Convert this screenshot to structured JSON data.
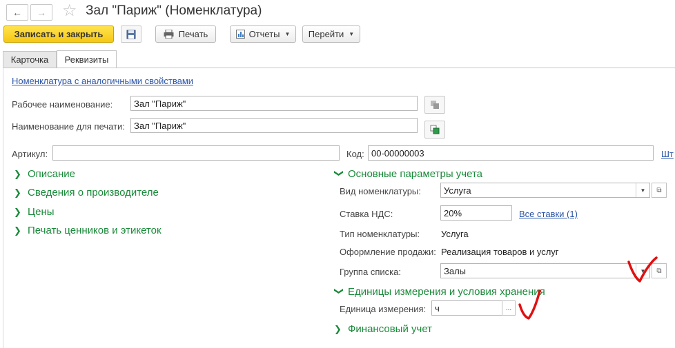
{
  "window": {
    "title": "Зал \"Париж\" (Номенклатура)",
    "back_icon": "arrow-left-icon",
    "forward_icon": "arrow-right-icon",
    "favorite_icon": "star-icon"
  },
  "toolbar": {
    "save_close": "Записать и закрыть",
    "print": "Печать",
    "reports": "Отчеты",
    "goto": "Перейти"
  },
  "tabs": [
    {
      "label": "Карточка",
      "active": false
    },
    {
      "label": "Реквизиты",
      "active": true
    }
  ],
  "form": {
    "similar_link": "Номенклатура с аналогичными свойствами",
    "work_name_label": "Рабочее наименование:",
    "work_name_value": "Зал \"Париж\"",
    "print_name_label": "Наименование для печати:",
    "print_name_value": "Зал \"Париж\"",
    "article_label": "Артикул:",
    "article_value": "",
    "code_label": "Код:",
    "code_value": "00-00000003",
    "barcode_link": "Шт"
  },
  "left_sections": [
    "Описание",
    "Сведения о производителе",
    "Цены",
    "Печать ценников и этикеток"
  ],
  "accounting": {
    "header": "Основные параметры учета",
    "kind_label": "Вид номенклатуры:",
    "kind_value": "Услуга",
    "vat_label": "Ставка НДС:",
    "vat_value": "20%",
    "all_rates_link": "Все ставки (1)",
    "type_label": "Тип номенклатуры:",
    "type_value": "Услуга",
    "sale_label": "Оформление продажи:",
    "sale_value": "Реализация товаров и услуг",
    "group_label": "Группа списка:",
    "group_value": "Залы"
  },
  "units": {
    "header": "Единицы измерения и условия хранения",
    "unit_label": "Единица измерения:",
    "unit_value": "ч",
    "unit_button": "..."
  },
  "finance": {
    "header": "Финансовый учет"
  },
  "colors": {
    "primary_button": "#f6c714",
    "section_green": "#1a8a3a",
    "link_blue": "#2b55a8",
    "annotation_red": "#e01010"
  }
}
